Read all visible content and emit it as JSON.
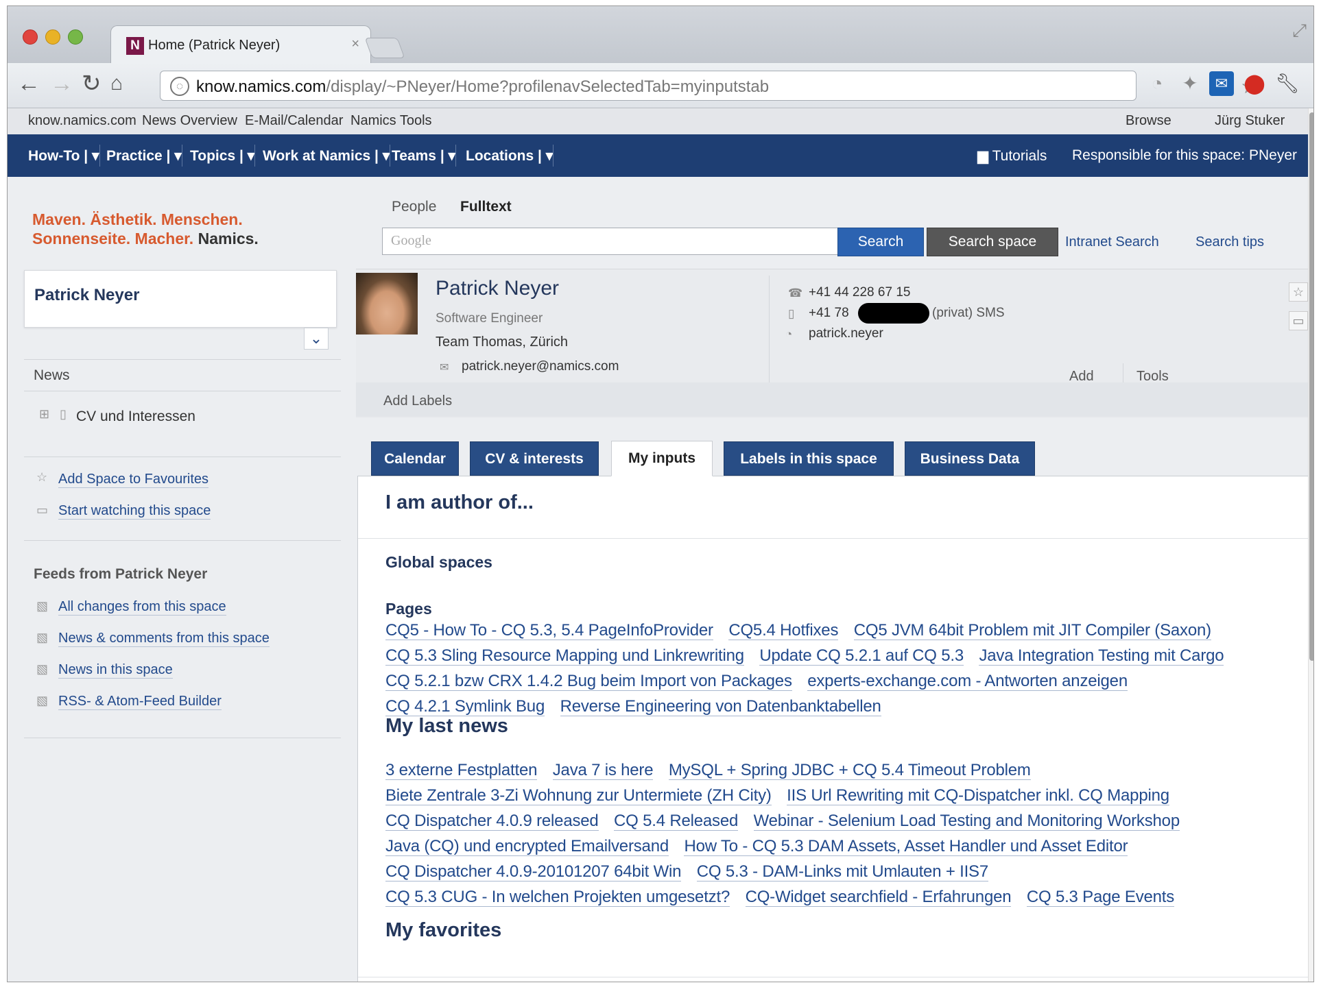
{
  "browser": {
    "tab_title": "Home (Patrick Neyer)",
    "tab_favicon": "N",
    "tab_close": "×",
    "url_host": "know.namics.com",
    "url_path": "/display/~PNeyer/Home?profilenavSelectedTab=myinputstab",
    "icons": [
      "back-icon",
      "forward-icon",
      "reload-icon",
      "home-icon",
      "globe-icon",
      "bookmark-star-icon",
      "extension-icons",
      "wrench-icon"
    ]
  },
  "top_links": {
    "left": [
      "know.namics.com",
      "News Overview",
      "E-Mail/Calendar",
      "Namics Tools"
    ],
    "right": [
      "Browse",
      "Jürg Stuker"
    ]
  },
  "nav": {
    "items": [
      "How-To |",
      "Practice |",
      "Topics |",
      "Work at Namics |",
      "Teams |",
      "Locations |"
    ],
    "tutorials": "Tutorials",
    "responsible": "Responsible for this space: PNeyer"
  },
  "tagline": {
    "line1": "Maven. Ästhetik. Menschen.",
    "line2": "Sonnenseite. Macher.",
    "brand": "Namics."
  },
  "sidebar": {
    "profile_name": "Patrick Neyer",
    "news_heading": "News",
    "tree_item": "CV und Interessen",
    "actions": [
      "Add Space to Favourites",
      "Start watching this space"
    ],
    "feeds_heading": "Feeds from Patrick Neyer",
    "feeds": [
      "All changes from this space",
      "News & comments from this space",
      "News in this space",
      "RSS- & Atom-Feed Builder"
    ]
  },
  "search": {
    "tabs": [
      "People",
      "Fulltext"
    ],
    "placeholder": "Google",
    "search_button": "Search",
    "space_button": "Search space",
    "links": [
      "Intranet Search",
      "Search tips"
    ]
  },
  "profile": {
    "name": "Patrick Neyer",
    "title": "Software Engineer",
    "team": "Team Thomas, Zürich",
    "email": "patrick.neyer@namics.com",
    "phone": "+41 44 228 67 15",
    "mobile_prefix": "+41 78",
    "mobile_suffix": "(privat) SMS",
    "skype": "patrick.neyer",
    "add": "Add",
    "tools": "Tools",
    "add_labels": "Add Labels"
  },
  "tabs": [
    "Calendar",
    "CV & interests",
    "My inputs",
    "Labels in this space",
    "Business Data"
  ],
  "content": {
    "author_heading": "I am author of...",
    "global_spaces": "Global spaces",
    "pages_heading": "Pages",
    "pages": [
      "CQ5 - How To - CQ 5.3, 5.4 PageInfoProvider",
      "CQ5.4 Hotfixes",
      "CQ5 JVM 64bit Problem mit JIT Compiler (Saxon)",
      "CQ 5.3 Sling Resource Mapping und Linkrewriting",
      "Update CQ 5.2.1 auf CQ 5.3",
      "Java Integration Testing mit Cargo",
      "CQ 5.2.1 bzw CRX 1.4.2 Bug beim Import von Packages",
      "experts-exchange.com - Antworten anzeigen",
      "CQ 4.2.1 Symlink Bug",
      "Reverse Engineering von Datenbanktabellen"
    ],
    "news_heading": "My last news",
    "news": [
      "3 externe Festplatten",
      "Java 7 is here",
      "MySQL + Spring JDBC + CQ 5.4 Timeout Problem",
      "Biete Zentrale 3-Zi Wohnung zur Untermiete (ZH City)",
      "IIS Url Rewriting mit CQ-Dispatcher inkl. CQ Mapping",
      "CQ Dispatcher 4.0.9 released",
      "CQ 5.4 Released",
      "Webinar - Selenium Load Testing and Monitoring Workshop",
      "Java (CQ) und encrypted Emailversand",
      "How To - CQ 5.3 DAM Assets, Asset Handler und Asset Editor",
      "CQ Dispatcher 4.0.9-20101207 64bit Win",
      "CQ 5.3 - DAM-Links mit Umlauten + IIS7",
      "CQ 5.3 CUG - In welchen Projekten umgesetzt?",
      "CQ-Widget searchfield - Erfahrungen",
      "CQ 5.3 Page Events"
    ],
    "favorites_heading": "My favorites"
  }
}
